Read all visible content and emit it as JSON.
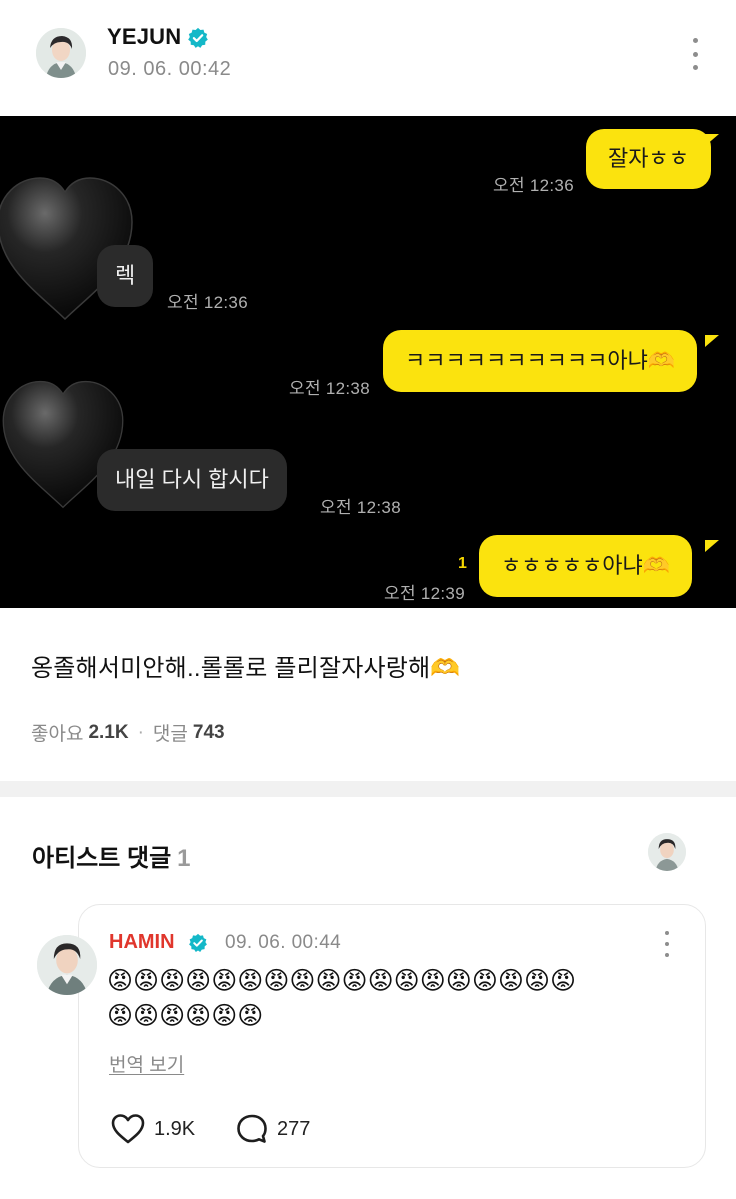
{
  "post": {
    "author": "YEJUN",
    "date": "09. 06. 00:42",
    "caption": "옹졸해서미안해..롤롤로 플리잘자사랑해🫶",
    "likes_label": "좋아요",
    "likes": "2.1K",
    "comments_label": "댓글",
    "comments": "743"
  },
  "chat": {
    "messages": [
      {
        "side": "out",
        "text": "잘자ㅎㅎ",
        "time": "오전 12:36"
      },
      {
        "side": "in",
        "text": "렉",
        "time": "오전 12:36"
      },
      {
        "side": "out",
        "text": "ㅋㅋㅋㅋㅋㅋㅋㅋㅋㅋ아냐🫶",
        "time": "오전 12:38"
      },
      {
        "side": "in",
        "text": "내일 다시 합시다",
        "time": "오전 12:38"
      },
      {
        "side": "out",
        "text": "ㅎㅎㅎㅎㅎ아냐🫶",
        "time": "오전 12:39",
        "unread": "1"
      }
    ]
  },
  "artist_comments": {
    "title": "아티스트 댓글",
    "count": "1",
    "comment": {
      "author": "HAMIN",
      "date": "09. 06. 00:44",
      "line1": "😡😡😡😡😡😡😡😡😡😡😡😡😡😡😡😡😡😡",
      "line2": "😡😡😡😡😡😡",
      "translate_label": "번역 보기",
      "likes": "1.9K",
      "replies": "277"
    }
  },
  "colors": {
    "outgoing_bubble": "#fbe30e",
    "incoming_bubble": "#2b2b2b",
    "chat_background": "#000000",
    "verified_badge": "#14b8c8",
    "artist_name": "#e0362c"
  },
  "icons": [
    "verified-icon",
    "more-vertical-icon",
    "heart-icon",
    "comment-bubble-icon"
  ]
}
